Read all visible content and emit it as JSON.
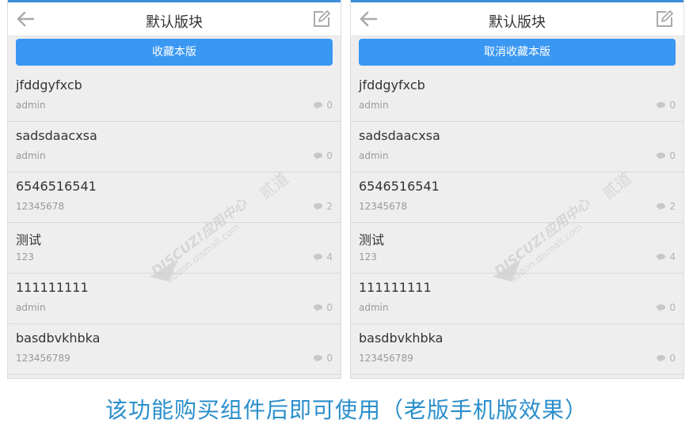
{
  "screens": [
    {
      "title": "默认版块",
      "action_label": "收藏本版",
      "threads": [
        {
          "title": "jfddgyfxcb",
          "author": "admin",
          "replies": "0"
        },
        {
          "title": "sadsdaacxsa",
          "author": "admin",
          "replies": "0"
        },
        {
          "title": "6546516541",
          "author": "12345678",
          "replies": "2"
        },
        {
          "title": "测试",
          "author": "123",
          "replies": "4"
        },
        {
          "title": "111111111",
          "author": "admin",
          "replies": "0"
        },
        {
          "title": "basdbvkhbka",
          "author": "123456789",
          "replies": "0"
        }
      ]
    },
    {
      "title": "默认版块",
      "action_label": "取消收藏本版",
      "threads": [
        {
          "title": "jfddgyfxcb",
          "author": "admin",
          "replies": "0"
        },
        {
          "title": "sadsdaacxsa",
          "author": "admin",
          "replies": "0"
        },
        {
          "title": "6546516541",
          "author": "12345678",
          "replies": "2"
        },
        {
          "title": "测试",
          "author": "123",
          "replies": "4"
        },
        {
          "title": "111111111",
          "author": "admin",
          "replies": "0"
        },
        {
          "title": "basdbvkhbka",
          "author": "123456789",
          "replies": "0"
        }
      ]
    }
  ],
  "watermark": {
    "brand": "DISCUZ!应用中心",
    "url": "addon.dismall.com",
    "mark": "贰道"
  },
  "caption": "该功能购买组件后即可使用（老版手机版效果）",
  "colors": {
    "accent": "#3a97f2",
    "caption": "#2a8ecb",
    "topbar_border": "#3a8fd6"
  },
  "icons": {
    "back": "back-arrow-icon",
    "edit": "edit-icon",
    "reply": "comment-bubble-icon"
  }
}
